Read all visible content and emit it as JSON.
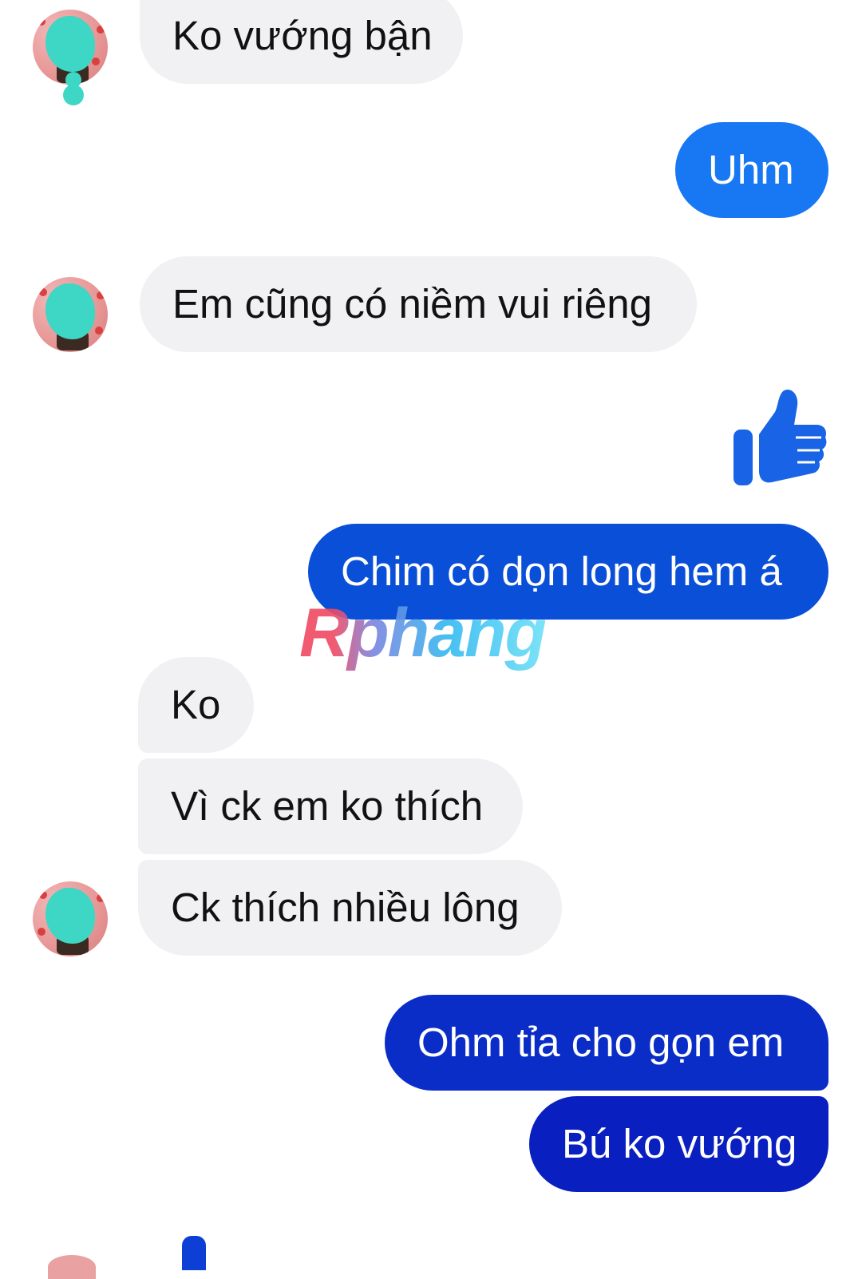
{
  "messages": [
    {
      "side": "received",
      "text": "Ko vướng bận"
    },
    {
      "side": "sent",
      "text": "Uhm"
    },
    {
      "side": "received",
      "text": "Em cũng có niềm vui riêng"
    },
    {
      "side": "sent",
      "type": "like",
      "icon": "thumbs-up-icon"
    },
    {
      "side": "sent",
      "text": "Chim có dọn long hem á"
    },
    {
      "side": "received",
      "text": "Ko"
    },
    {
      "side": "received",
      "text": "Vì ck em ko thích"
    },
    {
      "side": "received",
      "text": "Ck thích nhiều lông"
    },
    {
      "side": "sent",
      "text": "Ohm tỉa cho gọn em"
    },
    {
      "side": "sent",
      "text": "Bú ko vướng"
    }
  ],
  "watermark": "Rphang",
  "colors": {
    "received_bubble": "#f1f1f4",
    "sent_top": "#1877f2",
    "sent_mid": "#0a4fd8",
    "sent_bottom": "#0a1fbf",
    "like_icon": "#1863e6"
  }
}
